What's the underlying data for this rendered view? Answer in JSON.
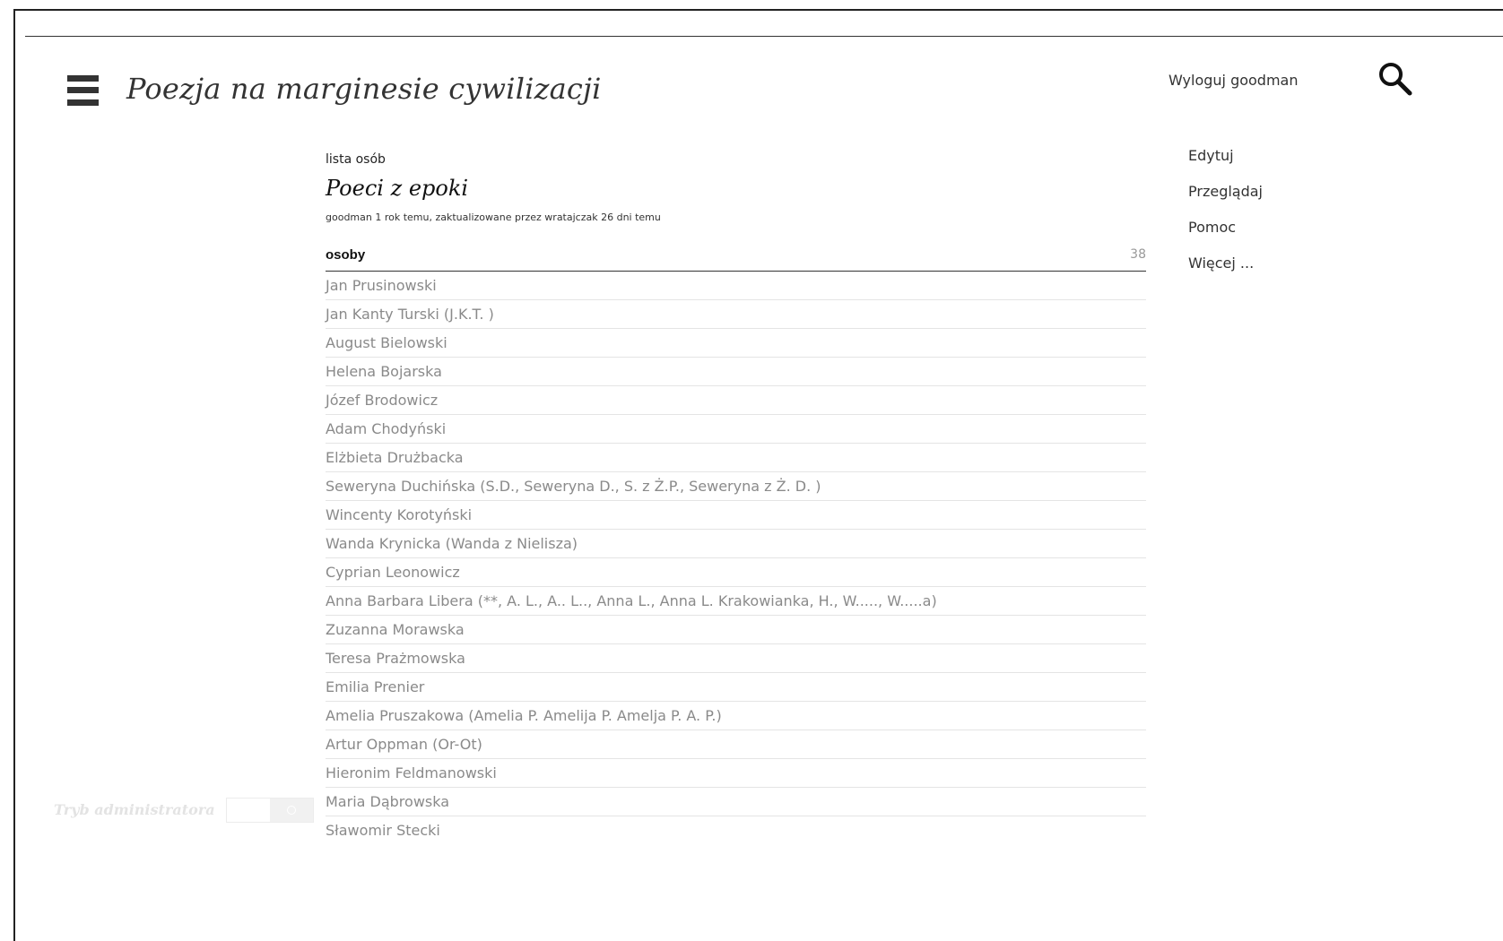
{
  "header": {
    "site_title": "Poezja na marginesie cywilizacji",
    "logout_label": "Wyloguj goodman",
    "menu_icon": "hamburger-menu-icon",
    "search_icon": "search-icon"
  },
  "side_menu": {
    "items": [
      {
        "label": "Edytuj"
      },
      {
        "label": "Przeglądaj"
      },
      {
        "label": "Pomoc"
      },
      {
        "label": "Więcej ..."
      }
    ]
  },
  "main": {
    "kind": "lista osób",
    "title": "Poeci z epoki",
    "meta": "goodman 1 rok temu, zaktualizowane przez wratajczak 26 dni temu",
    "list_label": "osoby",
    "list_count": "38",
    "people": [
      "Jan Prusinowski",
      "Jan Kanty Turski (J.K.T. )",
      "August Bielowski",
      "Helena Bojarska",
      "Józef Brodowicz",
      "Adam Chodyński",
      "Elżbieta Drużbacka",
      "Seweryna Duchińska (S.D., Seweryna D., S. z Ż.P., Seweryna z Ż. D. )",
      "Wincenty Korotyński",
      "Wanda Krynicka (Wanda z Nielisza)",
      "Cyprian Leonowicz",
      "Anna Barbara Libera (**, A. L., A.. L.., Anna L., Anna L. Krakowianka, H., W....., W.....a)",
      "Zuzanna Morawska",
      "Teresa Prażmowska",
      "Emilia Prenier",
      "Amelia Pruszakowa (Amelia P. Amelija P. Amelja P. A. P.)",
      "Artur Oppman (Or-Ot)",
      "Hieronim Feldmanowski",
      "Maria Dąbrowska",
      "Sławomir Stecki"
    ]
  },
  "admin": {
    "label": "Tryb administratora"
  },
  "colors": {
    "text": "#333333",
    "muted_link": "#8a8a8a",
    "count": "#999999"
  }
}
